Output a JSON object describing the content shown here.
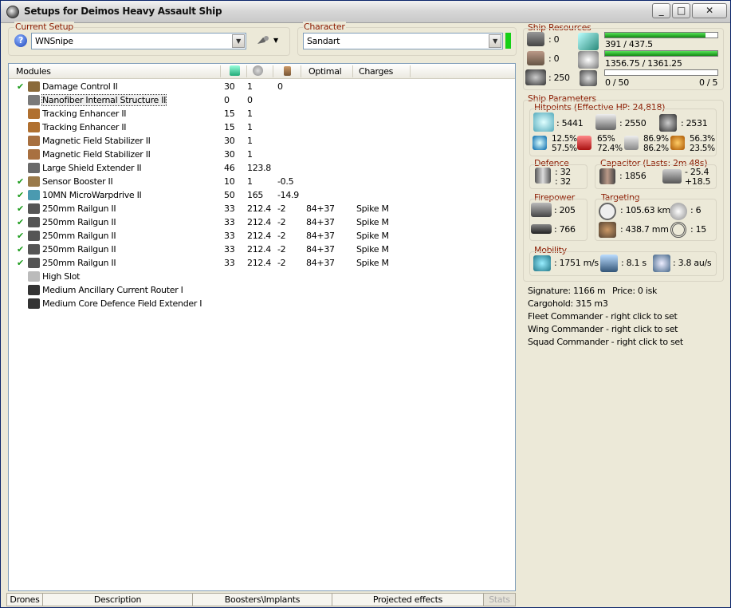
{
  "window": {
    "title": "Setups for Deimos Heavy Assault Ship",
    "buttons": {
      "minimize": "_",
      "maximize": "□",
      "close": "✕"
    }
  },
  "setup": {
    "label": "Current Setup",
    "value": "WNSnipe"
  },
  "character": {
    "label": "Character",
    "value": "Sandart"
  },
  "columns": {
    "name": "Modules",
    "optimal": "Optimal",
    "charges": "Charges"
  },
  "modules": [
    {
      "checked": true,
      "name": "Damage Control II",
      "cpu": "30",
      "power": "1",
      "cap": "0",
      "optimal": "",
      "charges": "",
      "icon": "#8a6a3a"
    },
    {
      "checked": false,
      "name": "Nanofiber Internal Structure II",
      "cpu": "0",
      "power": "0",
      "cap": "",
      "optimal": "",
      "charges": "",
      "icon": "#7a7a7a",
      "selected": true
    },
    {
      "checked": false,
      "name": "Tracking Enhancer II",
      "cpu": "15",
      "power": "1",
      "cap": "",
      "optimal": "",
      "charges": "",
      "icon": "#b07030"
    },
    {
      "checked": false,
      "name": "Tracking Enhancer II",
      "cpu": "15",
      "power": "1",
      "cap": "",
      "optimal": "",
      "charges": "",
      "icon": "#b07030"
    },
    {
      "checked": false,
      "name": "Magnetic Field Stabilizer II",
      "cpu": "30",
      "power": "1",
      "cap": "",
      "optimal": "",
      "charges": "",
      "icon": "#a87040"
    },
    {
      "checked": false,
      "name": "Magnetic Field Stabilizer II",
      "cpu": "30",
      "power": "1",
      "cap": "",
      "optimal": "",
      "charges": "",
      "icon": "#a87040"
    },
    {
      "checked": false,
      "name": "Large Shield Extender II",
      "cpu": "46",
      "power": "123.8",
      "cap": "",
      "optimal": "",
      "charges": "",
      "icon": "#6a6a6a"
    },
    {
      "checked": true,
      "name": "Sensor Booster II",
      "cpu": "10",
      "power": "1",
      "cap": "-0.5",
      "optimal": "",
      "charges": "",
      "icon": "#9a7a4a"
    },
    {
      "checked": true,
      "name": "10MN MicroWarpdrive II",
      "cpu": "50",
      "power": "165",
      "cap": "-14.9",
      "optimal": "",
      "charges": "",
      "icon": "#4a9ab0"
    },
    {
      "checked": true,
      "name": "250mm Railgun II",
      "cpu": "33",
      "power": "212.4",
      "cap": "-2",
      "optimal": "84+37",
      "charges": "Spike M",
      "icon": "#555"
    },
    {
      "checked": true,
      "name": "250mm Railgun II",
      "cpu": "33",
      "power": "212.4",
      "cap": "-2",
      "optimal": "84+37",
      "charges": "Spike M",
      "icon": "#555"
    },
    {
      "checked": true,
      "name": "250mm Railgun II",
      "cpu": "33",
      "power": "212.4",
      "cap": "-2",
      "optimal": "84+37",
      "charges": "Spike M",
      "icon": "#555"
    },
    {
      "checked": true,
      "name": "250mm Railgun II",
      "cpu": "33",
      "power": "212.4",
      "cap": "-2",
      "optimal": "84+37",
      "charges": "Spike M",
      "icon": "#555"
    },
    {
      "checked": true,
      "name": "250mm Railgun II",
      "cpu": "33",
      "power": "212.4",
      "cap": "-2",
      "optimal": "84+37",
      "charges": "Spike M",
      "icon": "#555"
    },
    {
      "checked": false,
      "name": "High Slot",
      "cpu": "",
      "power": "",
      "cap": "",
      "optimal": "",
      "charges": "",
      "icon": "#bbb"
    },
    {
      "checked": false,
      "name": "Medium Ancillary Current Router I",
      "cpu": "",
      "power": "",
      "cap": "",
      "optimal": "",
      "charges": "",
      "icon": "#333"
    },
    {
      "checked": false,
      "name": "Medium Core Defence Field Extender I",
      "cpu": "",
      "power": "",
      "cap": "",
      "optimal": "",
      "charges": "",
      "icon": "#333"
    }
  ],
  "tabs": [
    "Drones",
    "Description",
    "Boosters\\Implants",
    "Projected effects",
    "Stats"
  ],
  "resources": {
    "label": "Ship Resources",
    "turret": ": 0",
    "launcher": ": 0",
    "drone_bay": ": 250",
    "cpu": "391 / 437.5",
    "cpu_fill": 0.894,
    "power": "1356.75 / 1361.25",
    "power_fill": 0.997,
    "drones": "0 / 50",
    "drones_fill": 0,
    "drones_active": "0 / 5"
  },
  "params": {
    "label": "Ship Parameters",
    "hitpoints_label": "Hitpoints (Effective HP: 24,818)",
    "shield_hp": ": 5441",
    "armor_hp": ": 2550",
    "structure_hp": ": 2531",
    "res_em": [
      "12.5%",
      "57.5%"
    ],
    "res_therm": [
      "65%",
      "72.4%"
    ],
    "res_kin": [
      "86.9%",
      "86.2%"
    ],
    "res_exp": [
      "56.3%",
      "23.5%"
    ],
    "defence_label": "Defence",
    "defence": [
      ": 32",
      ": 32"
    ],
    "cap_label": "Capacitor (Lasts: 2m 48s)",
    "cap_total": ": 1856",
    "cap_delta": [
      "- 25.4",
      "+18.5"
    ],
    "firepower_label": "Firepower",
    "firepower": [
      ": 205",
      ": 766"
    ],
    "targeting_label": "Targeting",
    "target_range": ": 105.63 km",
    "max_targets": ": 6",
    "scan_res": ": 438.7 mm",
    "sensor_str": ": 15",
    "mobility_label": "Mobility",
    "speed": ": 1751 m/s",
    "align": ": 8.1 s",
    "warp": ": 3.8 au/s"
  },
  "info": {
    "signature": "Signature: 1166 m",
    "price": "Price: 0 isk",
    "cargo": "Cargohold: 315 m3",
    "fleet": "Fleet Commander - right click to set",
    "wing": "Wing Commander - right click to set",
    "squad": "Squad Commander - right click to set"
  }
}
